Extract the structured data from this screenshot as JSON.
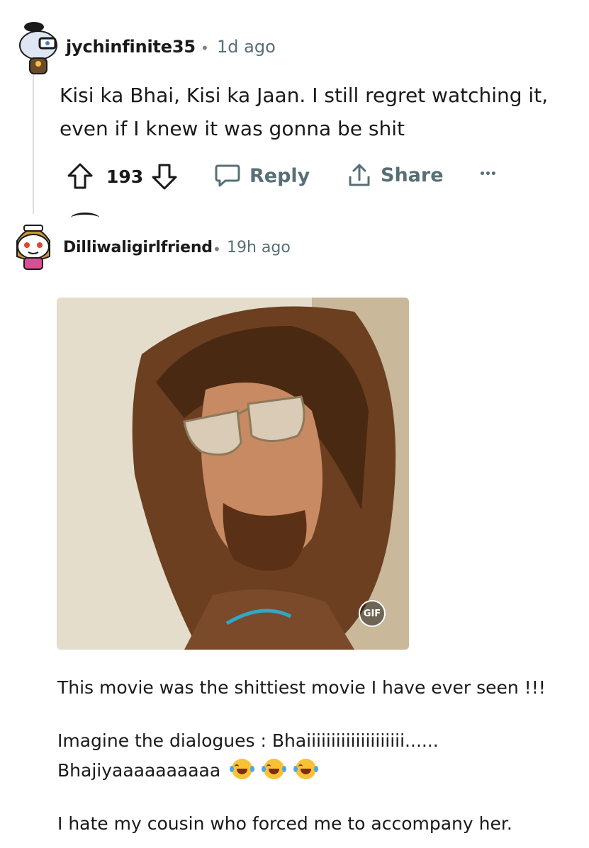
{
  "comments": [
    {
      "username": "jychinfinite35",
      "separator": "•",
      "time": "1d ago",
      "text_lines": [
        "Kisi ka Bhai, Kisi ka Jaan. I still regret watching it,",
        "even if I knew it was gonna be shit"
      ],
      "votes": "193",
      "reply_label": "Reply",
      "share_label": "Share",
      "more_label": "•••"
    },
    {
      "username": "Dilliwaligirlfriend",
      "separator": "•",
      "time": "19h ago",
      "gif_badge": "GIF",
      "paragraphs": [
        "This movie was the shittiest movie I have ever seen !!!",
        "Imagine the dialogues : Bhaiiiiiiiiiiiiiiiiiiii......",
        "Bhajiyaaaaaaaaaa",
        "I hate my cousin who forced me to accompany her."
      ],
      "emoji_names": [
        "face-with-tears-of-joy",
        "face-with-tears-of-joy",
        "face-with-tears-of-joy"
      ]
    }
  ],
  "colors": {
    "text": "#1a1a1b",
    "meta": "#576f76",
    "thread_line": "#dadde0"
  }
}
